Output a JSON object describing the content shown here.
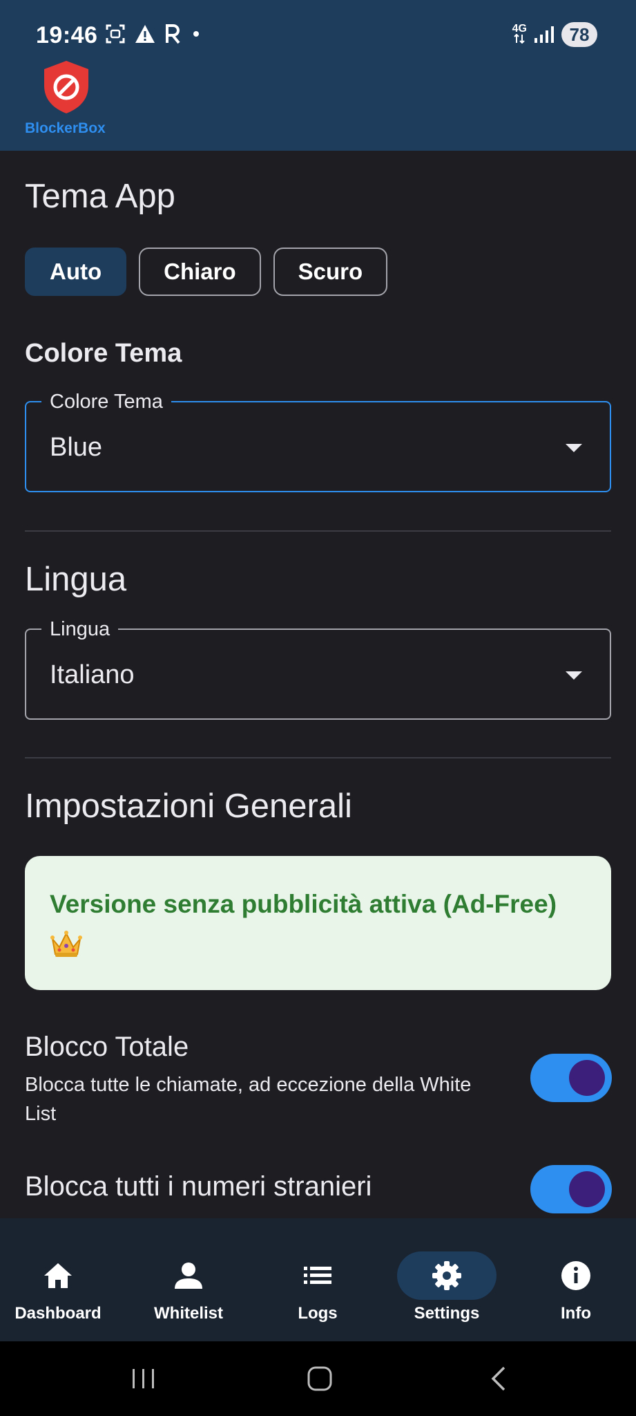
{
  "status_bar": {
    "time": "19:46",
    "network": "4G",
    "battery": "78"
  },
  "app": {
    "brand": "BlockerBox",
    "accent_color": "#2f8ff0",
    "bar_color": "#1e3c5c"
  },
  "theme": {
    "heading": "Tema App",
    "options": [
      "Auto",
      "Chiaro",
      "Scuro"
    ],
    "selected": "Auto"
  },
  "color_theme": {
    "heading": "Colore Tema",
    "field_label": "Colore Tema",
    "value": "Blue"
  },
  "language": {
    "heading": "Lingua",
    "field_label": "Lingua",
    "value": "Italiano"
  },
  "general": {
    "heading": "Impostazioni Generali",
    "adfree_text": "Versione senza pubblicità attiva (Ad-Free)",
    "adfree_icon": "crown-icon",
    "settings": [
      {
        "title": "Blocco Totale",
        "description": "Blocca tutte le chiamate, ad eccezione della White List",
        "enabled": true
      },
      {
        "title": "Blocca tutti i numeri stranieri",
        "enabled": true
      }
    ]
  },
  "bottom_nav": {
    "items": [
      {
        "label": "Dashboard",
        "icon": "home-icon"
      },
      {
        "label": "Whitelist",
        "icon": "person-icon"
      },
      {
        "label": "Logs",
        "icon": "list-icon"
      },
      {
        "label": "Settings",
        "icon": "gear-icon"
      },
      {
        "label": "Info",
        "icon": "info-icon"
      }
    ],
    "active": "Settings"
  },
  "system_nav": {
    "buttons": [
      "recents-icon",
      "home-button-icon",
      "back-icon"
    ]
  }
}
